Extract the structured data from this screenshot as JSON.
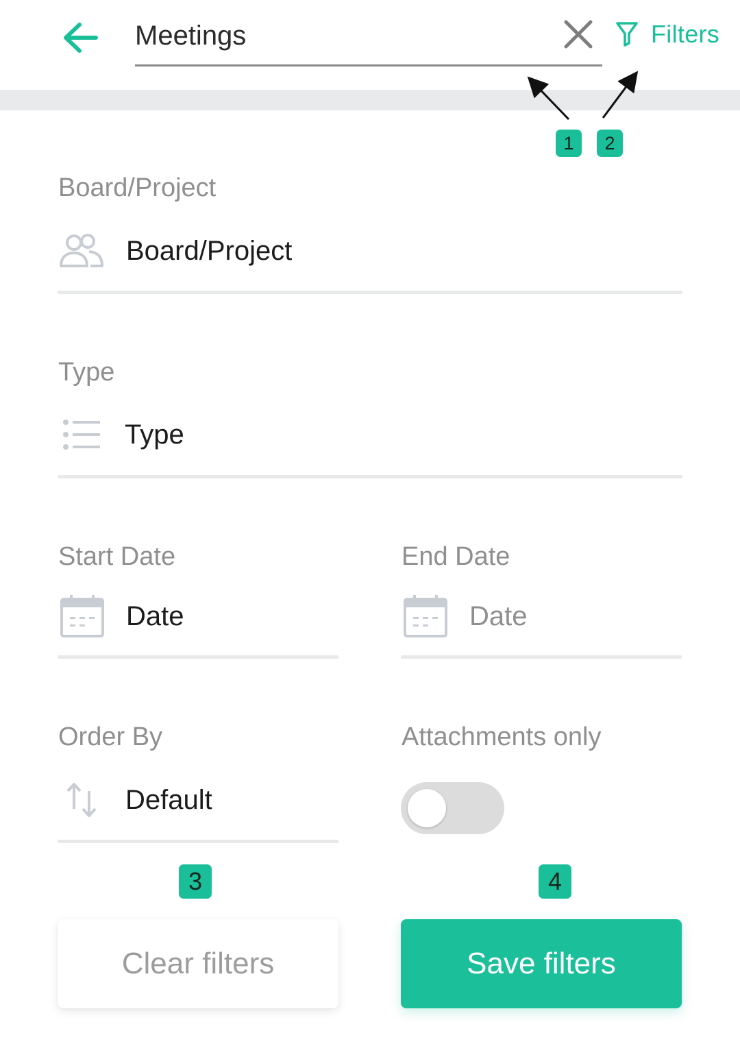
{
  "header": {
    "search_value": "Meetings",
    "filters_label": "Filters"
  },
  "callouts": [
    "1",
    "2",
    "3",
    "4"
  ],
  "form": {
    "board": {
      "label": "Board/Project",
      "value": "Board/Project",
      "icon": "people-icon"
    },
    "type": {
      "label": "Type",
      "value": "Type",
      "icon": "list-icon"
    },
    "start_date": {
      "label": "Start Date",
      "value": "Date",
      "icon": "calendar-icon"
    },
    "end_date": {
      "label": "End Date",
      "value": "Date",
      "icon": "calendar-icon"
    },
    "order_by": {
      "label": "Order By",
      "value": "Default",
      "icon": "sort-icon"
    },
    "attachments": {
      "label": "Attachments only",
      "enabled": false
    }
  },
  "buttons": {
    "clear_label": "Clear filters",
    "save_label": "Save filters"
  },
  "colors": {
    "accent": "#1abf9a",
    "label_gray": "#8f8f8f",
    "divider": "#e8e9eb"
  }
}
